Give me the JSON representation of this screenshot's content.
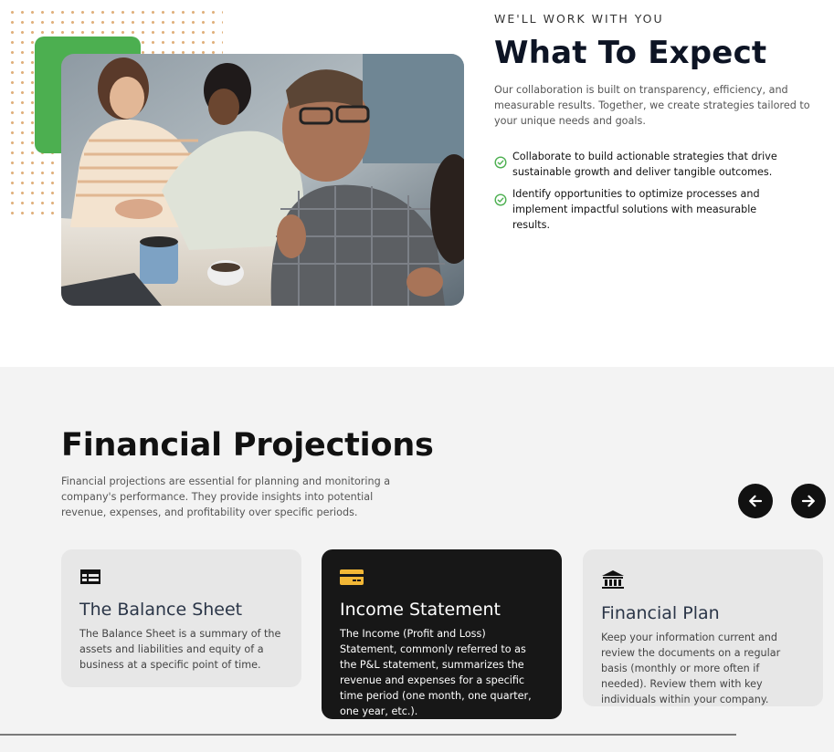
{
  "expect": {
    "eyebrow": "WE'LL WORK WITH YOU",
    "title": "What To Expect",
    "description": "Our collaboration is built on transparency, efficiency, and measurable results. Together, we create strategies tailored to your unique needs and goals.",
    "bullets": [
      "Collaborate to build actionable strategies that drive sustainable growth and deliver tangible outcomes.",
      "Identify opportunities to optimize processes and implement impactful solutions with measurable results."
    ],
    "check_icon": "check-circle-icon",
    "accent_color": "#4caf50",
    "photo": "team-meeting-photo"
  },
  "financial": {
    "title": "Financial Projections",
    "description": "Financial projections are essential for planning and monitoring a company's performance. They provide insights into potential revenue, expenses, and profitability over specific periods.",
    "nav": {
      "prev_icon": "arrow-left-icon",
      "next_icon": "arrow-right-icon"
    },
    "cards": [
      {
        "icon": "table-icon",
        "title": "The Balance Sheet",
        "body": "The Balance Sheet is a summary of the assets and liabilities and equity of a business at a specific point of time.",
        "active": false
      },
      {
        "icon": "credit-card-icon",
        "title": "Income Statement",
        "body": "The Income (Profit and Loss) Statement, commonly referred to as the P&L statement, summarizes the revenue and expenses for a specific time period (one month, one quarter, one year, etc.).",
        "active": true
      },
      {
        "icon": "bank-icon",
        "title": "Financial Plan",
        "body": "Keep your information current and review the documents on a regular basis (monthly or more often if needed). Review them with key individuals within your company.",
        "active": false
      }
    ],
    "icon_accent_color": "#f2b736",
    "active_card_color": "#171717"
  }
}
